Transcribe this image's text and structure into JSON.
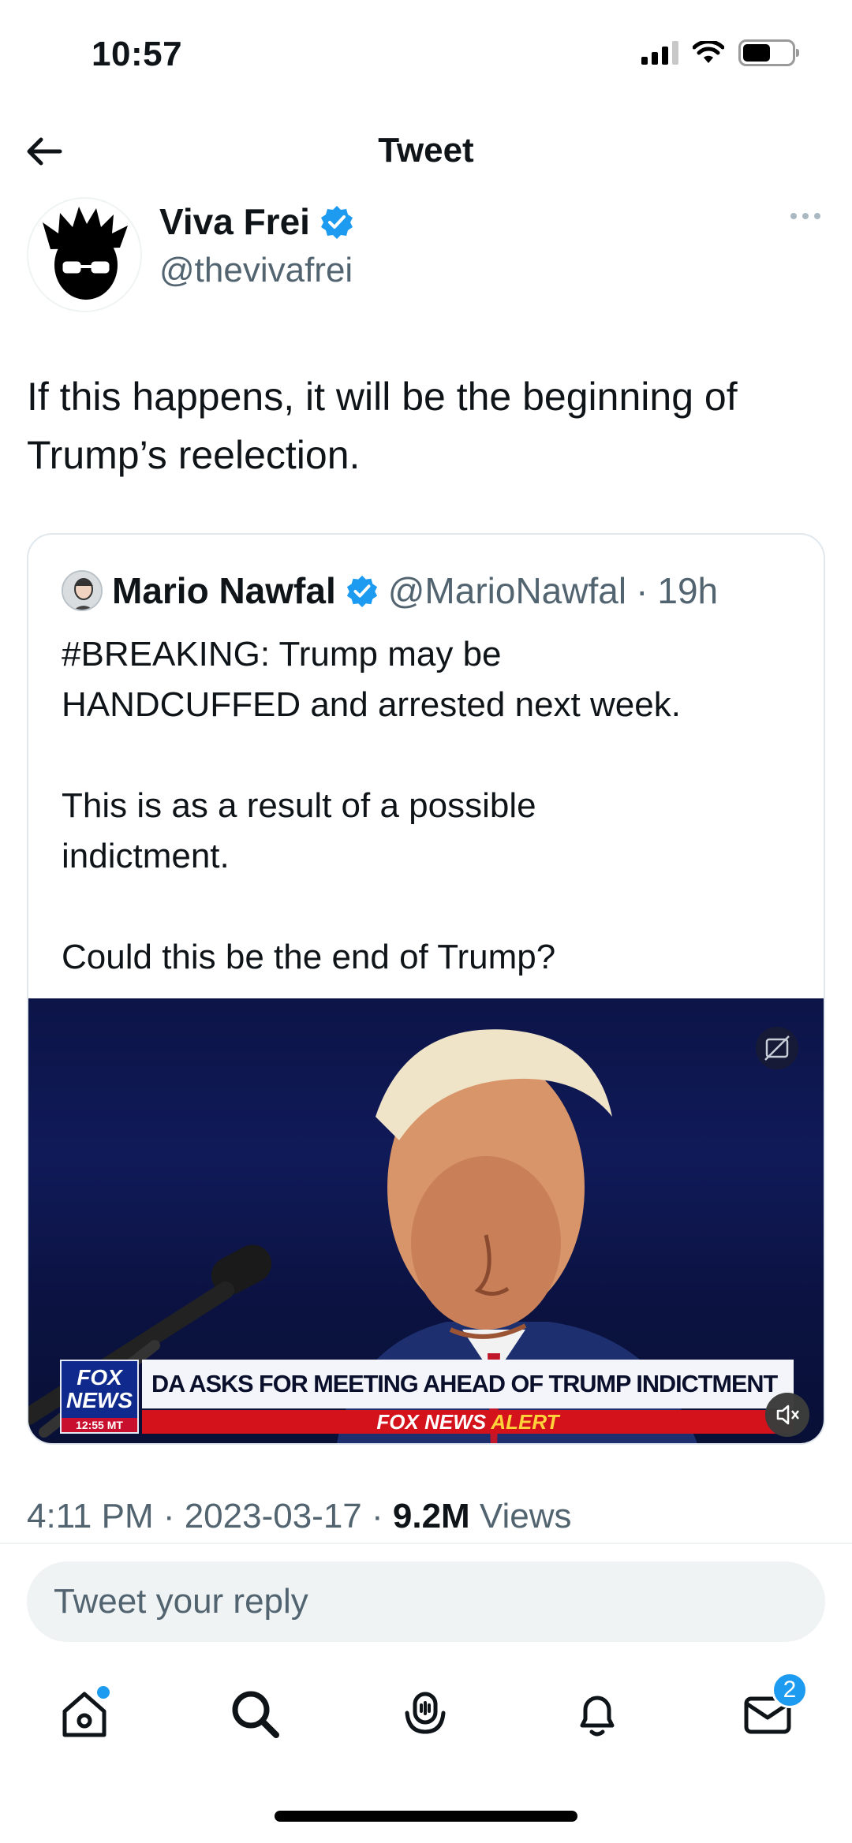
{
  "status_bar": {
    "time": "10:57"
  },
  "header": {
    "title": "Tweet"
  },
  "tweet": {
    "author_name": "Viva Frei",
    "author_handle": "@thevivafrei",
    "text": "If this happens, it will be the beginning of Trump’s reelection.",
    "timestamp": "4:11 PM · 2023-03-17 · ",
    "views_count": "9.2M",
    "views_label": " Views"
  },
  "quote": {
    "author_name": "Mario Nawfal",
    "author_handle": "@MarioNawfal",
    "separator": "·",
    "time": "19h",
    "text": "#BREAKING: Trump may be\nHANDCUFFED and arrested next week.\n\nThis is as a result of a possible\nindictment.\n\nCould this be the end of Trump?",
    "video": {
      "logo_line1": "FOX",
      "logo_line2": "NEWS",
      "clock": "12:55 MT",
      "headline": "DA ASKS FOR MEETING AHEAD OF TRUMP INDICTMENT",
      "alert_white": "FOX NEWS ",
      "alert_yellow": "ALERT"
    }
  },
  "reply": {
    "placeholder": "Tweet your reply"
  },
  "nav": {
    "messages_badge": "2"
  },
  "colors": {
    "accent": "#1d9bf0",
    "secondary_text": "#536471",
    "fox_red": "#d4121c",
    "fox_blue": "#0f2a8c"
  }
}
